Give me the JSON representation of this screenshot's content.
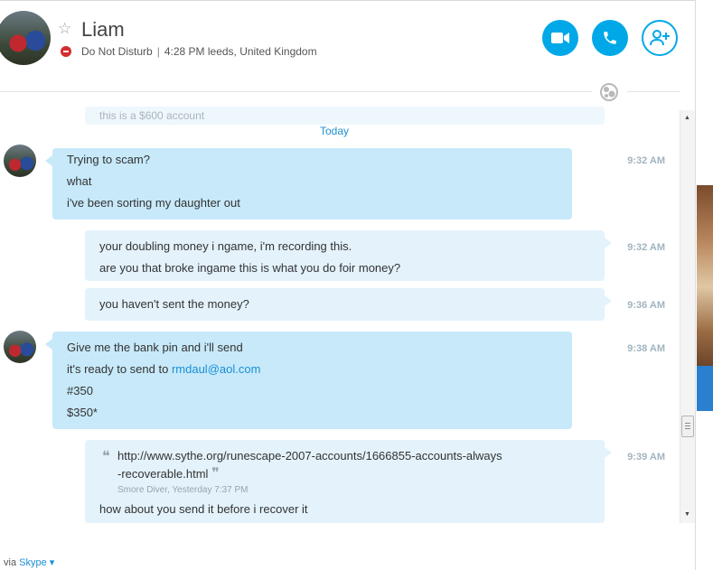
{
  "header": {
    "contact_name": "Liam",
    "status": "Do Not Disturb",
    "separator": "|",
    "local_time_location": "4:28 PM leeds, United Kingdom",
    "buttons": {
      "video": "video-camera-icon",
      "call": "phone-icon",
      "add": "add-contact-icon"
    }
  },
  "conversation": {
    "previous_message_partial": "this is a $600 account",
    "day_separator": "Today",
    "messages": [
      {
        "direction": "incoming",
        "time": "9:32 AM",
        "lines": [
          "Trying to scam?",
          "what",
          "i've been sorting my daughter out"
        ]
      },
      {
        "direction": "outgoing",
        "time": "9:32 AM",
        "lines": [
          "your doubling money i ngame, i'm recording this.",
          "are you that broke ingame this is what you do foir money?"
        ]
      },
      {
        "direction": "outgoing",
        "time": "9:36 AM",
        "lines": [
          "you haven't sent the money?"
        ]
      },
      {
        "direction": "incoming",
        "time": "9:38 AM",
        "lines": [
          "Give me the bank pin and i'll send",
          "it's ready to send to",
          "#350",
          "$350*"
        ],
        "link": "rmdaul@aol.com"
      },
      {
        "direction": "outgoing",
        "time": "9:39 AM",
        "quote": {
          "open_mark": "❝",
          "close_mark": "❞",
          "line1": "http://www.sythe.org/runescape-2007-accounts/1666855-accounts-always",
          "line2": "-recoverable.html",
          "meta": "Smore Diver, Yesterday 7:37 PM"
        },
        "lines": [
          "how about you send it before i recover it"
        ]
      }
    ]
  },
  "footer": {
    "via": "via",
    "app": "Skype",
    "dropdown_icon": "caret-down-icon"
  },
  "colors": {
    "accent": "#00a8e8",
    "incoming_bubble": "#c7e9f9",
    "outgoing_bubble": "#e3f2fb",
    "link": "#1a8fd6",
    "dnd_red": "#d22d2d"
  }
}
